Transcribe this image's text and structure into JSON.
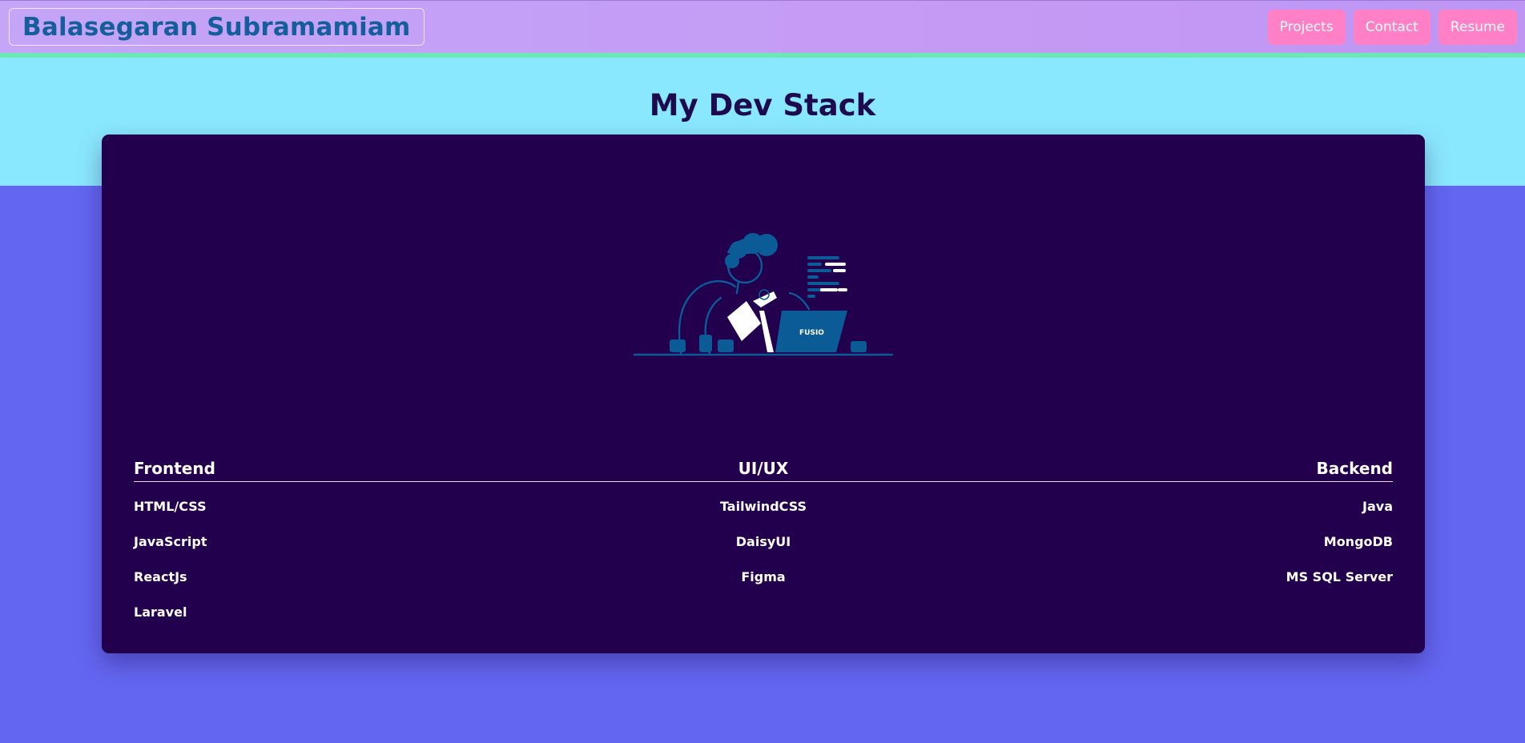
{
  "navbar": {
    "brand": "Balasegaran Subramamiam",
    "links": [
      {
        "label": "Projects"
      },
      {
        "label": "Contact"
      },
      {
        "label": "Resume"
      }
    ]
  },
  "main": {
    "title": "My Dev Stack",
    "illustration": {
      "laptop_label": "FUSIO",
      "icon": "developer-at-laptop-illustration"
    },
    "columns": {
      "frontend": {
        "title": "Frontend",
        "items": [
          "HTML/CSS",
          "JavaScript",
          "ReactJs",
          "Laravel"
        ]
      },
      "uiux": {
        "title": "UI/UX",
        "items": [
          "TailwindCSS",
          "DaisyUI",
          "Figma"
        ]
      },
      "backend": {
        "title": "Backend",
        "items": [
          "Java",
          "MongoDB",
          "MS SQL Server"
        ]
      }
    }
  },
  "colors": {
    "navbar": "#c49cf5",
    "brand_text": "#155e9c",
    "nav_button": "#ff80c6",
    "hero_band": "#8ae8fe",
    "page_bg": "#6366f1",
    "card_bg": "#22004d",
    "title_text": "#1e0a4f"
  }
}
